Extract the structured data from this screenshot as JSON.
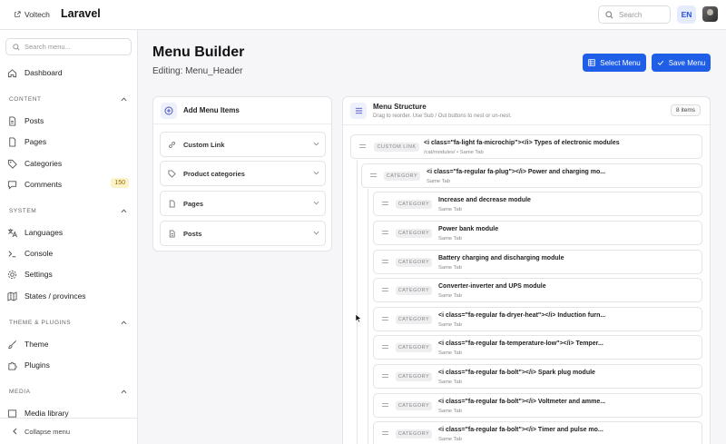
{
  "topbar": {
    "brand": "Voltech",
    "app_name": "Laravel",
    "search_placeholder": "Search",
    "language": "EN"
  },
  "sidebar": {
    "search_placeholder": "Search menu...",
    "dashboard": "Dashboard",
    "content_section": "CONTENT",
    "posts": "Posts",
    "pages": "Pages",
    "categories": "Categories",
    "comments": "Comments",
    "comments_badge": "150",
    "system_section": "SYSTEM",
    "languages": "Languages",
    "console": "Console",
    "settings": "Settings",
    "states": "States / provinces",
    "theme_section": "THEME & PLUGINS",
    "theme": "Theme",
    "plugins": "Plugins",
    "media_section": "MEDIA",
    "media_library": "Media library",
    "collapse": "Collapse menu"
  },
  "page": {
    "title": "Menu Builder",
    "editing": "Editing: Menu_Header",
    "select_menu": "Select Menu",
    "save_menu": "Save Menu"
  },
  "add_panel": {
    "title": "Add Menu Items",
    "items": [
      "Custom Link",
      "Product categories",
      "Pages",
      "Posts"
    ]
  },
  "structure": {
    "title": "Menu Structure",
    "subtitle": "Drag to reorder. Use Sub / Out buttons to nest or un-nest.",
    "count": "8 items",
    "nodes": [
      {
        "type": "CUSTOM LINK",
        "name": "<i class=\"fa-light fa-microchip\"></i> Types of electronic modules",
        "sub": "/cat/modules/ • Same Tab"
      },
      {
        "type": "CATEGORY",
        "name": "<i class=\"fa-regular fa-plug\"></i> Power and charging mo...",
        "sub": "Same Tab"
      },
      {
        "type": "CATEGORY",
        "name": "Increase and decrease module",
        "sub": "Same Tab"
      },
      {
        "type": "CATEGORY",
        "name": "Power bank module",
        "sub": "Same Tab"
      },
      {
        "type": "CATEGORY",
        "name": "Battery charging and discharging module",
        "sub": "Same Tab"
      },
      {
        "type": "CATEGORY",
        "name": "Converter-inverter and UPS module",
        "sub": "Same Tab"
      },
      {
        "type": "CATEGORY",
        "name": "<i class=\"fa-regular fa-dryer-heat\"></i> Induction furn...",
        "sub": "Same Tab"
      },
      {
        "type": "CATEGORY",
        "name": "<i class=\"fa-regular fa-temperature-low\"></i> Temper...",
        "sub": "Same Tab"
      },
      {
        "type": "CATEGORY",
        "name": "<i class=\"fa-regular fa-bolt\"></i> Spark plug module",
        "sub": "Same Tab"
      },
      {
        "type": "CATEGORY",
        "name": "<i class=\"fa-regular fa-bolt\"></i> Voltmeter and amme...",
        "sub": "Same Tab"
      },
      {
        "type": "CATEGORY",
        "name": "<i class=\"fa-regular fa-bolt\"></i> Timer and pulse mo...",
        "sub": "Same Tab"
      }
    ]
  }
}
